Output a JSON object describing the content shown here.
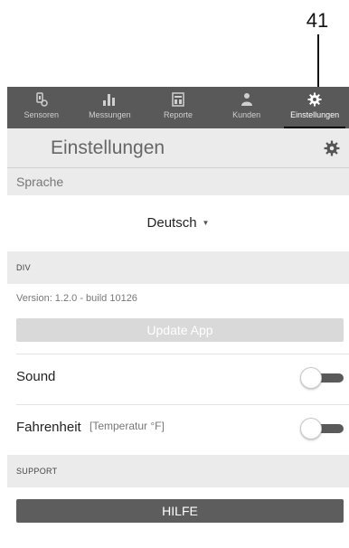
{
  "callout": {
    "number": "41"
  },
  "nav": {
    "items": [
      {
        "label": "Sensoren",
        "icon": "sensor-icon"
      },
      {
        "label": "Messungen",
        "icon": "bar-chart-icon"
      },
      {
        "label": "Reporte",
        "icon": "report-icon"
      },
      {
        "label": "Kunden",
        "icon": "customers-icon"
      },
      {
        "label": "Einstellungen",
        "icon": "gear-icon",
        "active": true
      }
    ]
  },
  "header": {
    "title": "Einstellungen"
  },
  "language": {
    "section": "Sprache",
    "selected": "Deutsch",
    "caret": "▼"
  },
  "div_section": {
    "label": "DIV",
    "version": "Version: 1.2.0 - build 10126",
    "update_button": "Update App"
  },
  "sound": {
    "label": "Sound",
    "enabled": false
  },
  "fahrenheit": {
    "label": "Fahrenheit",
    "sublabel": "[Temperatur °F]",
    "enabled": false
  },
  "support": {
    "label": "SUPPORT",
    "help_button": "HILFE"
  }
}
